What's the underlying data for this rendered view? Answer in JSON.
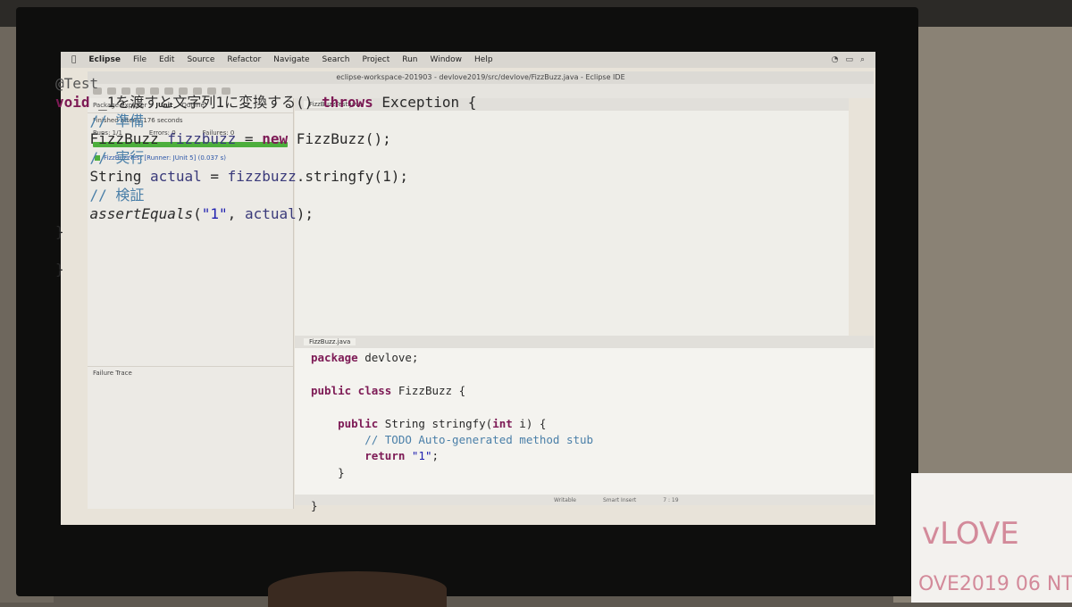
{
  "menubar": {
    "app": "Eclipse",
    "items": [
      "File",
      "Edit",
      "Source",
      "Refactor",
      "Navigate",
      "Search",
      "Project",
      "Run",
      "Window",
      "Help"
    ]
  },
  "window": {
    "title": "eclipse-workspace-201903 - devlove2019/src/devlove/FizzBuzz.java - Eclipse IDE"
  },
  "junit": {
    "tabs": [
      "Package Explorer",
      "JUnit",
      "Outline"
    ],
    "status": "Finished after 0.176 seconds",
    "runs": "Runs: 1/1",
    "errors": "Errors: 0",
    "failures": "Failures: 0",
    "test_item": "FizzBuzzTest [Runner: JUnit 5] (0.037 s)",
    "failure_trace": "Failure Trace"
  },
  "editor_top": {
    "tabs": [
      "FizzBuzzTest.java"
    ],
    "lines": [
      "@Test",
      "void _1を渡すと文字列1に変換する() throws Exception {",
      "    // 準備",
      "    FizzBuzz fizzbuzz = new FizzBuzz();",
      "    // 実行",
      "    String actual = fizzbuzz.stringfy(1);",
      "    // 検証",
      "    assertEquals(\"1\", actual);",
      "}",
      "",
      "}"
    ]
  },
  "editor_bottom": {
    "tab": "FizzBuzz.java",
    "lines": [
      "package devlove;",
      "",
      "public class FizzBuzz {",
      "",
      "    public String stringfy(int i) {",
      "        // TODO Auto-generated method stub",
      "        return \"1\";",
      "    }",
      "",
      "}"
    ]
  },
  "statusbar": {
    "mode": "Writable",
    "insert": "Smart Insert",
    "position": "7 : 19"
  },
  "whiteboard": {
    "line1": "vLOVE",
    "line2": "OVE2019 06 NT"
  }
}
